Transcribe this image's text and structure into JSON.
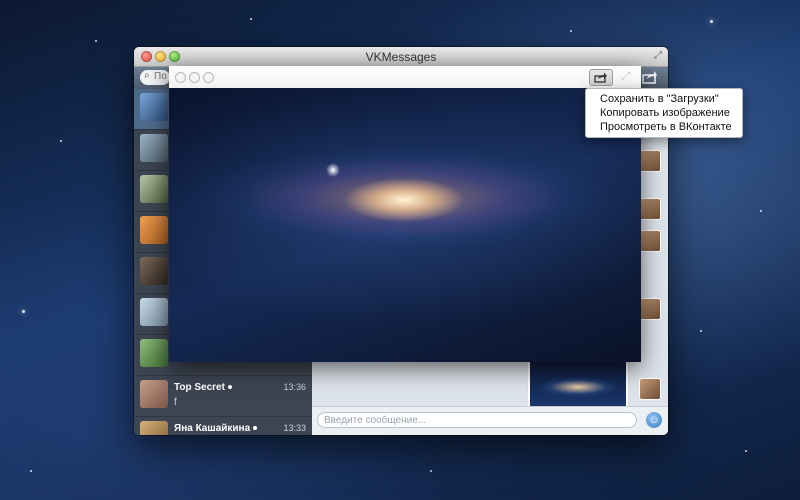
{
  "window": {
    "title": "VKMessages"
  },
  "search": {
    "placeholder": "По"
  },
  "conversations": [
    {
      "name": "Top Secret",
      "time": "13:36",
      "snippet": "f"
    },
    {
      "name": "Яна Кашайкина",
      "time": "13:33",
      "snippet": "😊"
    }
  ],
  "message_input": {
    "placeholder": "Введите сообщение..."
  },
  "context_menu": {
    "items": [
      "Сохранить в \"Загрузки\"",
      "Копировать изображение",
      "Просмотреть в ВКонтакте"
    ]
  },
  "icons": {
    "toolbar_share": "share-icon",
    "viewer_share": "share-icon",
    "viewer_expand": "expand-icon",
    "emoji": "smiley-icon",
    "search": "search-icon"
  },
  "colors": {
    "sidebar": "#3d4552",
    "selected_row": "#4f6b8c",
    "toolbar": "#5d6d80"
  }
}
